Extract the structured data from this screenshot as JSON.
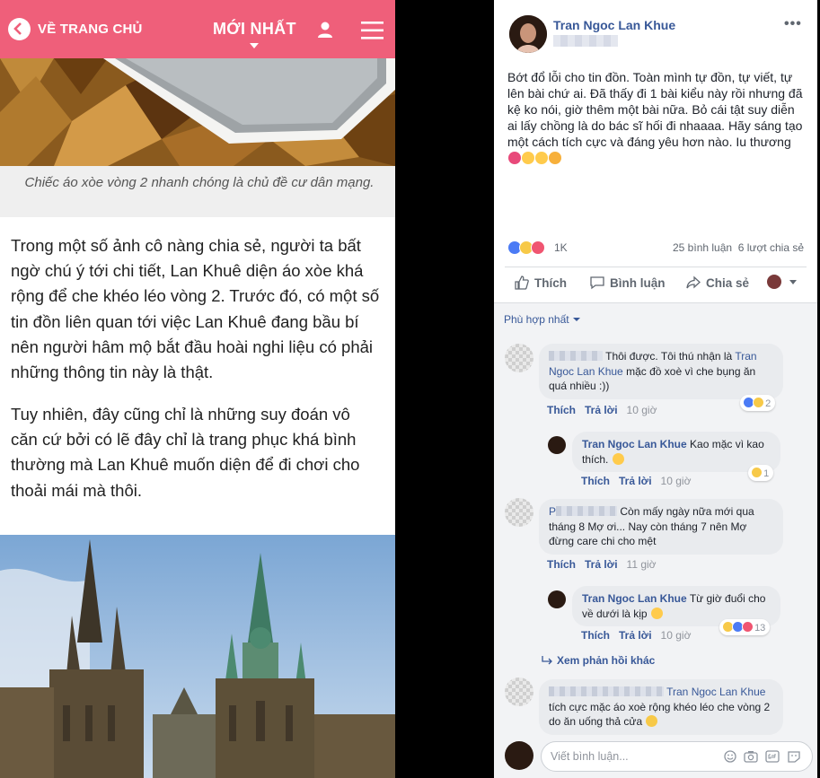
{
  "article": {
    "back_label": "VỀ TRANG CHỦ",
    "latest_label": "MỚI NHẤT",
    "caption": "Chiếc áo xòe vòng 2 nhanh chóng là chủ đề cư dân mạng.",
    "paragraphs": [
      "Trong một số ảnh cô nàng chia sẻ, người ta bất ngờ chú ý tới chi tiết, Lan Khuê diện áo xòe khá rộng để che khéo léo vòng 2. Trước đó, có một số tin đồn liên quan tới việc Lan Khuê đang bầu bí nên người hâm mộ bắt đầu hoài nghi liệu có phải những thông tin này là thật.",
      "Tuy nhiên, đây cũng chỉ là những suy đoán vô căn cứ bởi có lẽ đây chỉ là trang phục khá bình thường mà Lan Khuê muốn diện để đi chơi cho thoải mái mà thôi."
    ],
    "brand_color": "#ef5f7a"
  },
  "post": {
    "author": "Tran Ngoc Lan Khue",
    "more": "•••",
    "text": "Bớt đổ lỗi cho tin đồn. Toàn mình tự đồn, tự viết, tự lên bài chứ ai. Đã thấy đi 1 bài kiểu này rồi nhưng đã kệ ko nói, giờ thêm một bài nữa. Bỏ cái tật suy diễn ai lấy chồng là do bác sĩ hối đi nhaaaa. Hãy sáng tạo một cách tích cực và đáng yêu hơn nào. Iu thương",
    "reaction_count": "1K",
    "comment_count": "25 bình luận",
    "share_count": "6 lượt chia sẻ",
    "actions": {
      "like": "Thích",
      "comment": "Bình luận",
      "share": "Chia sẻ"
    },
    "link_color": "#385898"
  },
  "comments": {
    "sort_label": "Phù hợp nhất",
    "like_label": "Thích",
    "reply_label": "Trả lời",
    "items": [
      {
        "pre": "Thôi được. Tôi thú nhận là",
        "mention": "Tran Ngoc Lan Khue",
        "post": "mặc đồ xoè vì che bụng ăn quá nhiều :))",
        "time": "10 giờ",
        "reactions": "2"
      },
      {
        "name": "Tran Ngoc Lan Khue",
        "text": "Kao mặc vì kao thích.",
        "time": "10 giờ",
        "reactions": "1"
      },
      {
        "initial": "P",
        "text": "Còn mấy ngày nữa mới qua tháng 8 Mợ ơi... Nay còn tháng 7 nên Mợ đừng care chi cho mệt",
        "time": "11 giờ"
      },
      {
        "name": "Tran Ngoc Lan Khue",
        "text": "Từ giờ đuổi cho về dưới là kịp",
        "time": "10 giờ",
        "reactions": "13"
      },
      {
        "mention": "Tran Ngoc Lan Khue",
        "post": "tích cực mặc áo xoè rộng khéo léo che vòng 2 do ăn uống thả cửa"
      }
    ],
    "more_replies": "Xem phản hồi khác",
    "write_placeholder": "Viết bình luận..."
  },
  "icons": [
    "back-chevron-icon",
    "user-icon",
    "hamburger-menu-icon",
    "like-icon",
    "comment-icon",
    "share-icon",
    "more-icon",
    "camera-icon",
    "gif-icon",
    "sticker-icon",
    "emoji-icon"
  ]
}
